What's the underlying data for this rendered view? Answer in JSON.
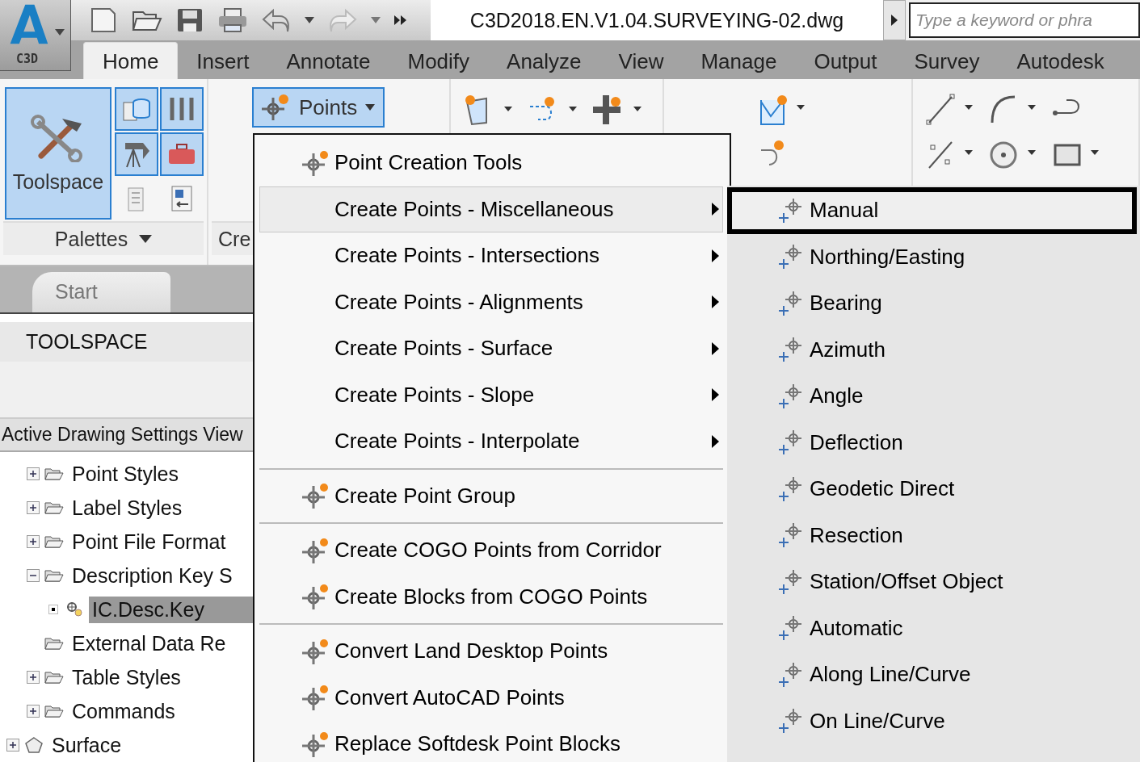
{
  "app_button": {
    "label": "C3D"
  },
  "title": "C3D2018.EN.V1.04.SURVEYING-02.dwg",
  "search": {
    "placeholder": "Type a keyword or phra"
  },
  "ribbon_tabs": [
    {
      "label": "Home",
      "selected": true
    },
    {
      "label": "Insert",
      "selected": false
    },
    {
      "label": "Annotate",
      "selected": false
    },
    {
      "label": "Modify",
      "selected": false
    },
    {
      "label": "Analyze",
      "selected": false
    },
    {
      "label": "View",
      "selected": false
    },
    {
      "label": "Manage",
      "selected": false
    },
    {
      "label": "Output",
      "selected": false
    },
    {
      "label": "Survey",
      "selected": false
    },
    {
      "label": "Autodesk",
      "selected": false
    }
  ],
  "ribbon": {
    "toolspace_button": {
      "label": "Toolspace",
      "selected": true
    },
    "palettes_panel": {
      "label": "Palettes"
    },
    "create_panel": {
      "label": "Cre"
    },
    "points_button": {
      "label": "Points",
      "selected": true
    }
  },
  "doc_tabs": [
    {
      "label": "Start"
    }
  ],
  "toolspace": {
    "title": "TOOLSPACE",
    "view_tab": "Active Drawing Settings View",
    "tree": [
      {
        "children": [
          {
            "label": "Point Styles",
            "kind": "folder",
            "expanded": false,
            "selected": false
          },
          {
            "label": "Label Styles",
            "kind": "folder",
            "expanded": false,
            "selected": false
          },
          {
            "label": "Point File Format",
            "kind": "folder",
            "expanded": false,
            "selected": false
          },
          {
            "label": "Description Key S",
            "kind": "folder",
            "expanded": true,
            "selected": false,
            "children": [
              {
                "label": "IC.Desc.Key",
                "kind": "key",
                "selected": true
              }
            ]
          },
          {
            "label": "External Data Re",
            "kind": "folder",
            "selected": false
          },
          {
            "label": "Table Styles",
            "kind": "folder",
            "expanded": false,
            "selected": false
          },
          {
            "label": "Commands",
            "kind": "folder",
            "expanded": false,
            "selected": false
          }
        ]
      },
      {
        "label": "Surface",
        "kind": "surface",
        "expanded": false,
        "selected": false
      }
    ]
  },
  "points_menu": {
    "items": [
      {
        "kind": "tool",
        "label": "Point Creation Tools",
        "selected": false
      },
      {
        "kind": "submenu",
        "label": "Create Points - Miscellaneous",
        "selected": true
      },
      {
        "kind": "submenu",
        "label": "Create Points - Intersections",
        "selected": false
      },
      {
        "kind": "submenu",
        "label": "Create Points - Alignments",
        "selected": false
      },
      {
        "kind": "submenu",
        "label": "Create Points - Surface",
        "selected": false
      },
      {
        "kind": "submenu",
        "label": "Create Points - Slope",
        "selected": false
      },
      {
        "kind": "submenu",
        "label": "Create Points - Interpolate",
        "selected": false
      },
      {
        "kind": "separator"
      },
      {
        "kind": "tool",
        "label": "Create Point Group",
        "selected": false
      },
      {
        "kind": "separator"
      },
      {
        "kind": "tool",
        "label": "Create COGO Points from Corridor",
        "selected": false
      },
      {
        "kind": "tool",
        "label": "Create Blocks from COGO Points",
        "selected": false
      },
      {
        "kind": "separator"
      },
      {
        "kind": "tool",
        "label": "Convert Land Desktop Points",
        "selected": false
      },
      {
        "kind": "tool",
        "label": "Convert AutoCAD Points",
        "selected": false
      },
      {
        "kind": "tool",
        "label": "Replace Softdesk Point Blocks",
        "selected": false
      }
    ]
  },
  "misc_submenu": {
    "items": [
      {
        "label": "Manual",
        "selected": true
      },
      {
        "label": "Northing/Easting",
        "selected": false
      },
      {
        "label": "Bearing",
        "selected": false
      },
      {
        "label": "Azimuth",
        "selected": false
      },
      {
        "label": "Angle",
        "selected": false
      },
      {
        "label": "Deflection",
        "selected": false
      },
      {
        "label": "Geodetic Direct",
        "selected": false
      },
      {
        "label": "Resection",
        "selected": false
      },
      {
        "label": "Station/Offset Object",
        "selected": false
      },
      {
        "label": "Automatic",
        "selected": false
      },
      {
        "label": "Along Line/Curve",
        "selected": false
      },
      {
        "label": "On Line/Curve",
        "selected": false
      }
    ]
  }
}
